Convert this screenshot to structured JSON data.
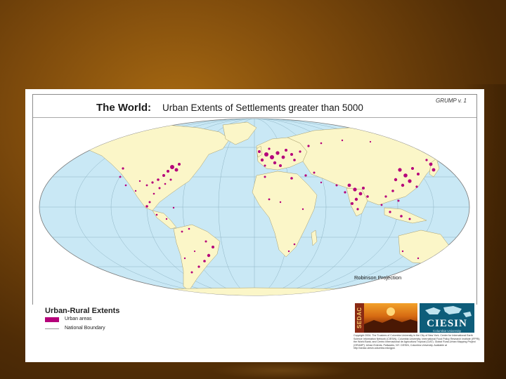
{
  "map": {
    "title_prefix": "The World:",
    "title": "Urban Extents of Settlements greater than 5000",
    "version": "GRUMP v. 1",
    "projection": "Robinson Projection"
  },
  "legend": {
    "title": "Urban-Rural Extents",
    "items": [
      {
        "label": "Urban areas",
        "color": "#b5007a"
      },
      {
        "label": "National Boundary",
        "color": "#999999"
      }
    ]
  },
  "logos": {
    "sedac": "SEDAC",
    "ciesin": "CIESIN",
    "ciesin_sub": "Columbia University"
  },
  "copyright": "Copyright 2004. The Trustees of Columbia University in the City of New York. Center for International Earth Science Information Network (CIESIN), Columbia University; International Food Policy Research Institute (IFPRI); the World Bank; and Centro Internacional de Agricultura Tropical (CIAT). Global Rural-Urban Mapping Project (GRUMP): Urban Extents. Palisades, NY: CIESIN, Columbia University. Available at http://sedac.ciesin.columbia.edu/gpw.",
  "colors": {
    "ocean": "#c9e8f5",
    "land": "#fbf6c8",
    "urban": "#b5007a",
    "background": "#7d4a0c"
  }
}
